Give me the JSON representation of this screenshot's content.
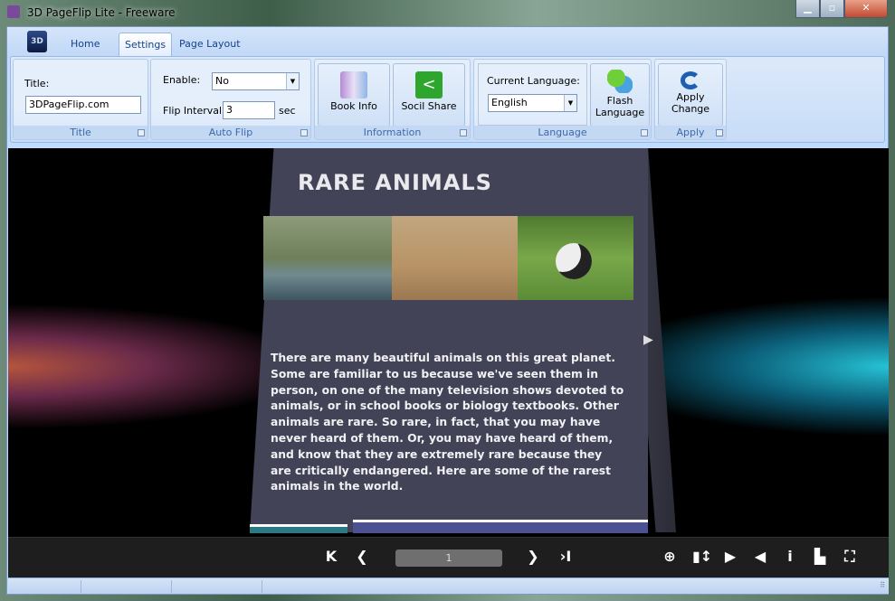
{
  "window": {
    "title": "3D PageFlip Lite - Freeware",
    "minimize": "▁",
    "maximize": "▫",
    "close": "✕"
  },
  "ribbon": {
    "app_button": "3D",
    "tabs": [
      {
        "label": "Home"
      },
      {
        "label": "Settings",
        "active": true
      },
      {
        "label": "Page Layout"
      }
    ],
    "groups": {
      "title": {
        "label": "Title",
        "field_label": "Title:",
        "value": "3DPageFlip.com"
      },
      "auto_flip": {
        "label": "Auto Flip",
        "enable_label": "Enable:",
        "enable_value": "No",
        "interval_label": "Flip Interval:",
        "interval_value": "3",
        "interval_unit": "sec"
      },
      "information": {
        "label": "Information",
        "book_info": "Book Info",
        "social_share": "Socil Share"
      },
      "language": {
        "label": "Language",
        "current_label": "Current Language:",
        "current_value": "English",
        "flash_language": [
          "Flash",
          "Language"
        ]
      },
      "apply": {
        "label": "Apply",
        "apply_change": [
          "Apply",
          "Change"
        ]
      }
    }
  },
  "book": {
    "page_title": "RARE ANIMALS",
    "body": "There are many beautiful animals on this great planet. Some are familiar to us because we've seen them in person, on one of the many television shows devoted to animals, or in school books or biology textbooks. Other animals are rare. So rare, in fact, that you may have never heard of them. Or, you may have heard of them, and know that they are extremely rare because they are critically endangered. Here are some of the rarest animals in the world."
  },
  "toolbar": {
    "first": "K",
    "prev": "❮",
    "page": "1",
    "next": "❯",
    "last": "›I",
    "icons": [
      "zoom-in",
      "page-mode",
      "autoplay",
      "sound",
      "info",
      "print",
      "fullscreen"
    ]
  }
}
